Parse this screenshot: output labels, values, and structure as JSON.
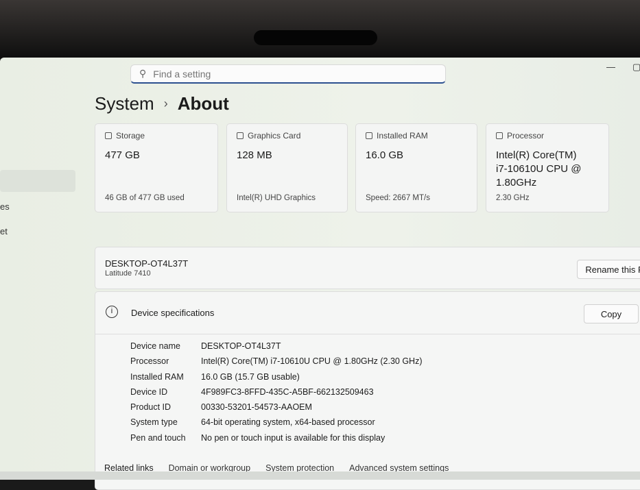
{
  "search": {
    "placeholder": "Find a setting"
  },
  "window": {
    "minimize": "—",
    "maximize": "▢"
  },
  "breadcrumb": {
    "parent": "System",
    "separator": "›",
    "current": "About"
  },
  "sidebar": {
    "items": [
      "es",
      "et"
    ]
  },
  "cards": [
    {
      "label": "Storage",
      "value": "477 GB",
      "sub": "46 GB of 477 GB used"
    },
    {
      "label": "Graphics Card",
      "value": "128 MB",
      "sub": "Intel(R) UHD Graphics"
    },
    {
      "label": "Installed RAM",
      "value": "16.0 GB",
      "sub": "Speed: 2667 MT/s"
    },
    {
      "label": "Processor",
      "value": "Intel(R) Core(TM) i7-10610U CPU @ 1.80GHz",
      "sub": "2.30 GHz"
    }
  ],
  "device": {
    "name": "DESKTOP-OT4L37T",
    "model": "Latitude 7410",
    "rename_label": "Rename this P"
  },
  "specs": {
    "title": "Device specifications",
    "copy_label": "Copy",
    "rows": [
      {
        "k": "Device name",
        "v": "DESKTOP-OT4L37T"
      },
      {
        "k": "Processor",
        "v": "Intel(R) Core(TM) i7-10610U CPU @ 1.80GHz (2.30 GHz)"
      },
      {
        "k": "Installed RAM",
        "v": "16.0 GB (15.7 GB usable)"
      },
      {
        "k": "Device ID",
        "v": "4F989FC3-8FFD-435C-A5BF-662132509463"
      },
      {
        "k": "Product ID",
        "v": "00330-53201-54573-AAOEM"
      },
      {
        "k": "System type",
        "v": "64-bit operating system, x64-based processor"
      },
      {
        "k": "Pen and touch",
        "v": "No pen or touch input is available for this display"
      }
    ]
  },
  "related": {
    "label": "Related links",
    "links": [
      "Domain or workgroup",
      "System protection",
      "Advanced system settings"
    ]
  }
}
